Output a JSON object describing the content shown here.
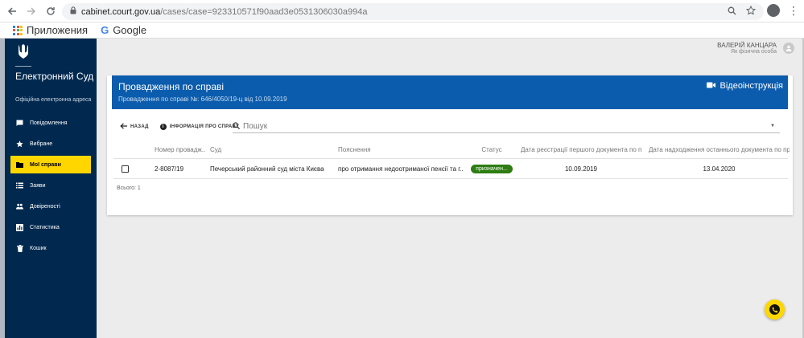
{
  "browser": {
    "url_host": "cabinet.court.gov.ua",
    "url_path": "/cases/case=923310571f90aad3e0531306030a994a",
    "bookmarks": [
      {
        "label": "Приложения",
        "icon": "apps-grid-icon"
      },
      {
        "label": "Google",
        "icon": "google-g-icon"
      }
    ]
  },
  "sidebar": {
    "title": "Електронний Суд",
    "subtitle": "Офіційна електронна адреса",
    "items": [
      {
        "label": "Повідомлення",
        "icon": "message-icon",
        "active": false
      },
      {
        "label": "Вибране",
        "icon": "star-icon",
        "active": false
      },
      {
        "label": "Мої справи",
        "icon": "folder-icon",
        "active": true
      },
      {
        "label": "Заяви",
        "icon": "list-icon",
        "active": false
      },
      {
        "label": "Довіреності",
        "icon": "people-icon",
        "active": false
      },
      {
        "label": "Статистика",
        "icon": "chart-icon",
        "active": false
      },
      {
        "label": "Кошик",
        "icon": "trash-icon",
        "active": false
      }
    ]
  },
  "user": {
    "name": "ВАЛЕРІЙ КАНЦАРА",
    "role": "Як фізична особа"
  },
  "header": {
    "title": "Провадження по справі",
    "subtitle": "Провадження по справі №: 646/4050/19-ц від 10.09.2019",
    "video_label": "Відеоінструкція"
  },
  "toolbar": {
    "back_label": "НАЗАД",
    "info_label": "ІНФОРМАЦІЯ ПРО СПРАВУ",
    "search_placeholder": "Пошук"
  },
  "table": {
    "columns": {
      "number": "Номер провадж...",
      "court": "Суд",
      "description": "Пояснення",
      "status": "Статус",
      "first_doc": "Дата реєстрації першого документа по пров",
      "last_doc": "Дата надходження останнього документа по прове"
    },
    "rows": [
      {
        "number": "2-8087/19",
        "court": "Печерський районний суд міста Києва",
        "description": "про отримання недоотриманої пенсії та г...",
        "status": "призначен...",
        "first_doc": "10.09.2019",
        "last_doc": "13.04.2020"
      }
    ],
    "total": "Всього: 1"
  },
  "colors": {
    "sidebar_bg": "#01294f",
    "accent_yellow": "#ffd600",
    "header_blue": "#0b5cad",
    "status_green": "#2e7d12"
  }
}
